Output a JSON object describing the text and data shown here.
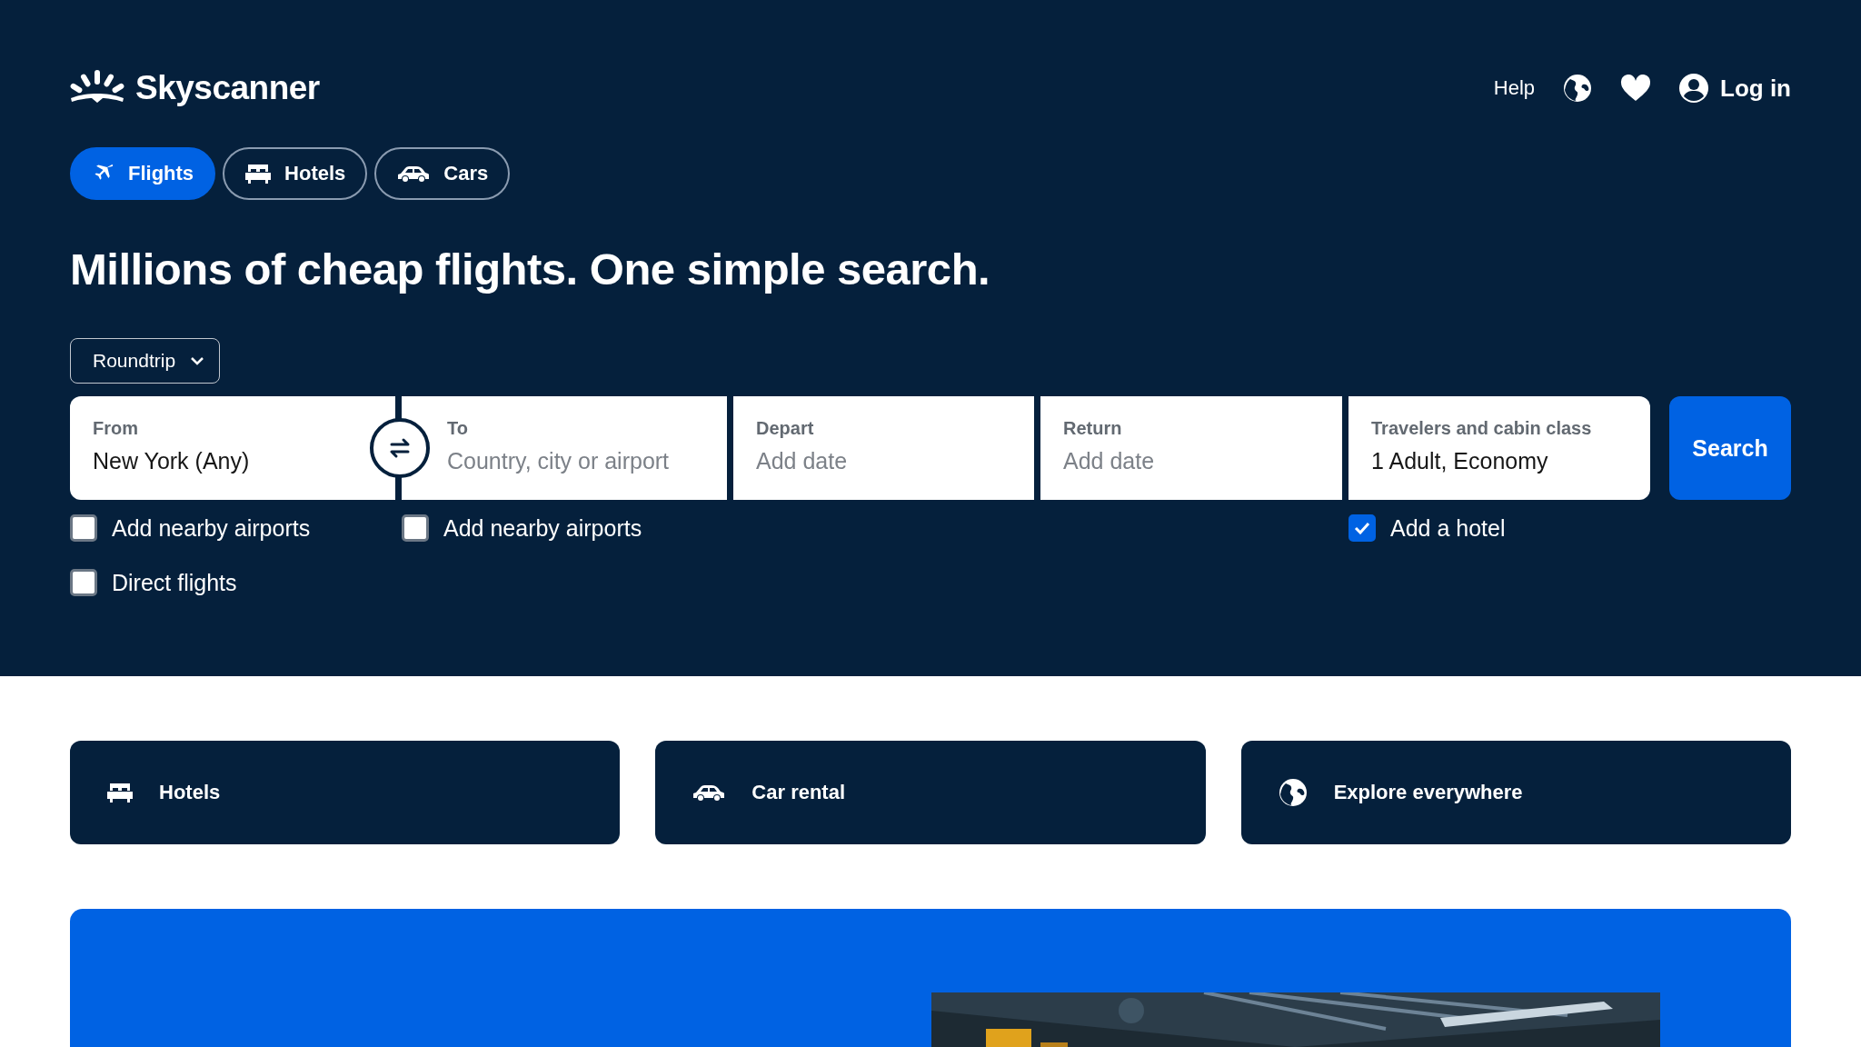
{
  "header": {
    "logo": "Skyscanner",
    "help": "Help",
    "login": "Log in"
  },
  "tabs": [
    {
      "label": "Flights",
      "kind": "plane",
      "selected": true
    },
    {
      "label": "Hotels",
      "kind": "bed",
      "selected": false
    },
    {
      "label": "Cars",
      "kind": "car",
      "selected": false
    }
  ],
  "headline": "Millions of cheap flights. One simple search.",
  "trip_type": "Roundtrip",
  "fields": [
    {
      "label": "From",
      "value": "New York (Any)",
      "options": [
        {
          "label": "Add nearby airports",
          "checked": false
        },
        {
          "label": "Direct flights",
          "checked": false
        }
      ]
    },
    {
      "label": "To",
      "placeholder": "Country, city or airport",
      "options": [
        {
          "label": "Add nearby airports",
          "checked": false
        }
      ]
    },
    {
      "label": "Depart",
      "placeholder": "Add date"
    },
    {
      "label": "Return",
      "placeholder": "Add date"
    },
    {
      "label": "Travelers and cabin class",
      "value": "1 Adult, Economy",
      "options": [
        {
          "label": "Add a hotel",
          "checked": true
        }
      ]
    }
  ],
  "search_button": "Search",
  "cards": [
    {
      "label": "Hotels",
      "kind": "bed"
    },
    {
      "label": "Car rental",
      "kind": "car"
    },
    {
      "label": "Explore everywhere",
      "kind": "globe"
    }
  ]
}
